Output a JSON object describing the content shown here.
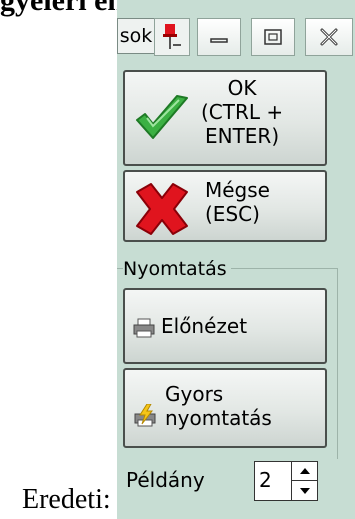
{
  "document": {
    "top_text": "gyeléri ehatás:",
    "bottom_text": "Eredeti:"
  },
  "titlebar": {
    "text": "sok",
    "pin_icon": "pin-icon",
    "minimize_icon": "minimize-icon",
    "maximize_icon": "maximize-icon",
    "close_icon": "close-icon"
  },
  "buttons": {
    "ok_label": "OK\n(CTRL +\nENTER)",
    "cancel_label": "Mégse\n(ESC)"
  },
  "print_group": {
    "title": "Nyomtatás",
    "preview_label": "Előnézet",
    "quick_print_label": "Gyors\nnyomtatás"
  },
  "copies": {
    "label": "Példány",
    "value": "2"
  },
  "colors": {
    "panel_bg": "#c7ddd3",
    "ok_check": "#3cb043",
    "cancel_x": "#e0141e"
  }
}
